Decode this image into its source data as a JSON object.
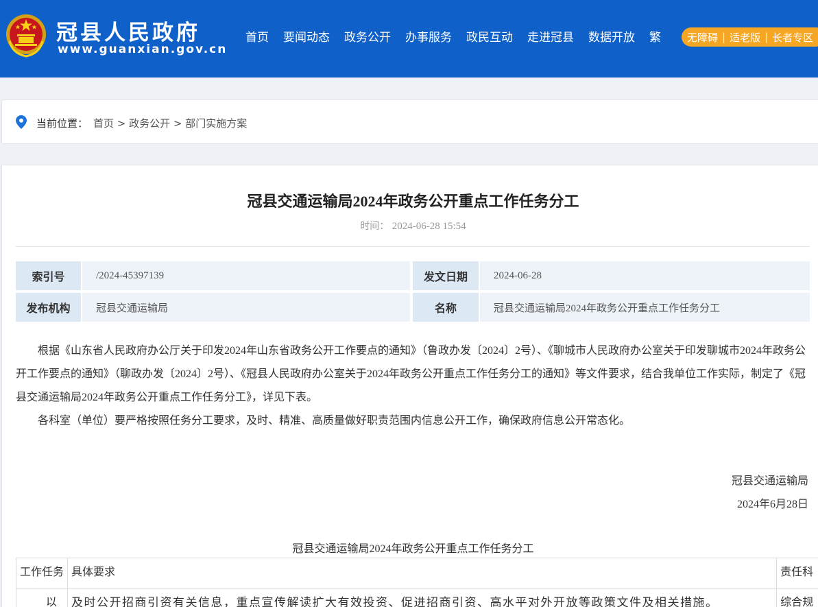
{
  "site": {
    "name": "冠县人民政府",
    "url": "www.guanxian.gov.cn"
  },
  "nav": [
    "首页",
    "要闻动态",
    "政务公开",
    "办事服务",
    "政民互动",
    "走进冠县",
    "数据开放",
    "繁"
  ],
  "accessibility": [
    "无障碍",
    "适老版",
    "长者专区"
  ],
  "breadcrumb": {
    "label": "当前位置：",
    "path": [
      "首页",
      "政务公开",
      "部门实施方案"
    ],
    "separator": " > "
  },
  "article": {
    "title": "冠县交通运输局2024年政务公开重点工作任务分工",
    "time_label": "时间：",
    "time_value": "2024-06-28 15:54",
    "meta": {
      "index_label": "索引号",
      "index_value": "/2024-45397139",
      "date_label": "发文日期",
      "date_value": "2024-06-28",
      "org_label": "发布机构",
      "org_value": "冠县交通运输局",
      "name_label": "名称",
      "name_value": "冠县交通运输局2024年政务公开重点工作任务分工"
    },
    "paragraphs": [
      "根据《山东省人民政府办公厅关于印发2024年山东省政务公开工作要点的通知》（鲁政办发〔2024〕2号）、《聊城市人民政府办公室关于印发聊城市2024年政务公开工作要点的通知》（聊政办发〔2024〕2号）、《冠县人民政府办公室关于2024年政务公开重点工作任务分工的通知》等文件要求，结合我单位工作实际，制定了《冠县交通运输局2024年政务公开重点工作任务分工》，详见下表。",
      "各科室（单位）要严格按照任务分工要求，及时、精准、高质量做好职责范围内信息公开工作，确保政府信息公开常态化。"
    ],
    "signature_org": "冠县交通运输局",
    "signature_date": "2024年6月28日",
    "table_title": "冠县交通运输局2024年政务公开重点工作任务分工",
    "table": {
      "headers": [
        "工作任务",
        "具体要求",
        "责任科"
      ],
      "rows": [
        {
          "task": "以",
          "requirement": "及时公开招商引资有关信息，重点宣传解读扩大有效投资、促进招商引资、高水平对外开放等政策文件及相关措施。",
          "responsible": "综合规"
        }
      ]
    }
  },
  "colors": {
    "header_bg": "#0f61c9",
    "accessibility_bg": "#f5a623",
    "meta_label_bg": "#dde8f5",
    "meta_value_bg": "#eef3f9",
    "page_bg": "#eef1f5"
  }
}
